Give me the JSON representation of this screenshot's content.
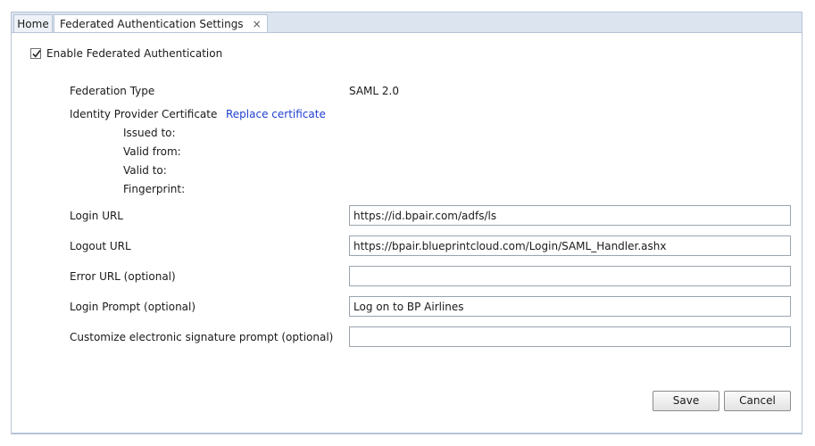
{
  "tabs": {
    "home": "Home",
    "active": "Federated Authentication Settings",
    "close_glyph": "×"
  },
  "enable": {
    "checked": true,
    "label": "Enable Federated Authentication"
  },
  "federation_type": {
    "label": "Federation Type",
    "value": "SAML 2.0"
  },
  "certificate": {
    "label": "Identity Provider Certificate",
    "replace_link": "Replace certificate",
    "issued_to": "Issued to:",
    "valid_from": "Valid from:",
    "valid_to": "Valid to:",
    "fingerprint": "Fingerprint:"
  },
  "fields": {
    "login_url": {
      "label": "Login URL",
      "value": "https://id.bpair.com/adfs/ls"
    },
    "logout_url": {
      "label": "Logout URL",
      "value": "https://bpair.blueprintcloud.com/Login/SAML_Handler.ashx"
    },
    "error_url": {
      "label": "Error URL (optional)",
      "value": ""
    },
    "login_prompt": {
      "label": "Login Prompt (optional)",
      "value": "Log on to BP Airlines"
    },
    "esig_prompt": {
      "label": "Customize electronic signature prompt (optional)",
      "value": ""
    }
  },
  "buttons": {
    "save": "Save",
    "cancel": "Cancel"
  },
  "colors": {
    "link": "#1f3fd0",
    "tab_bar": "#dce4ef",
    "border": "#b7c4d6"
  }
}
